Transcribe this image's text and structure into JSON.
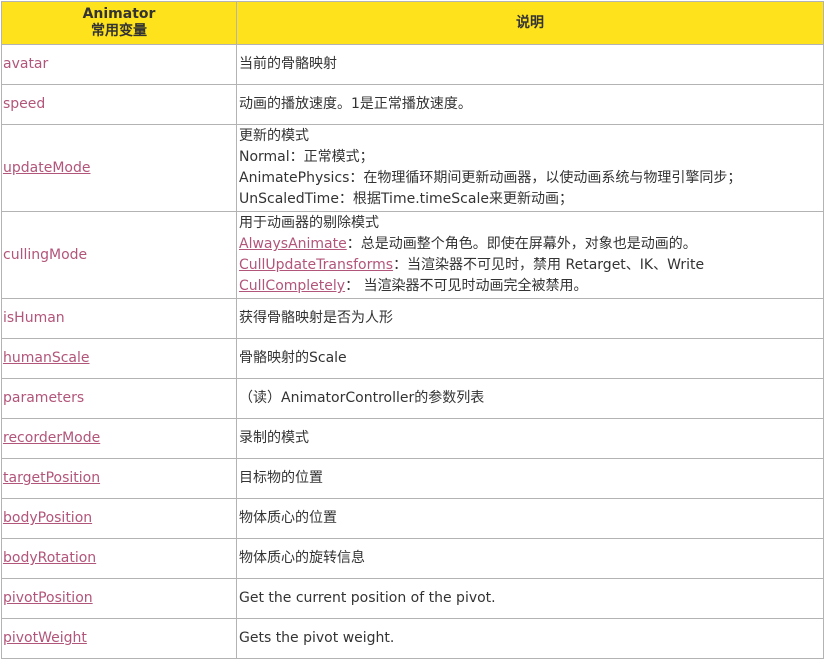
{
  "header": {
    "col1_line1": "Animator",
    "col1_line2": "常用变量",
    "col2": "说明"
  },
  "rows": [
    {
      "name": "avatar",
      "linked": false,
      "desc": "当前的骨骼映射"
    },
    {
      "name": "speed",
      "linked": false,
      "desc": "动画的播放速度。1是正常播放速度。"
    },
    {
      "name": "updateMode",
      "linked": true,
      "lines": [
        "更新的模式",
        "Normal：正常模式；",
        "AnimatePhysics：在物理循环期间更新动画器，以使动画系统与物理引擎同步；",
        "UnScaledTime：根据Time.timeScale来更新动画；"
      ]
    },
    {
      "name": "cullingMode",
      "linked": false,
      "intro": "用于动画器的剔除模式",
      "items": [
        {
          "link": "AlwaysAnimate",
          "text": "：总是动画整个角色。即使在屏幕外，对象也是动画的。"
        },
        {
          "link": "CullUpdateTransforms",
          "text": "：当渲染器不可见时，禁用 Retarget、IK、Write"
        },
        {
          "link": "CullCompletely",
          "text": "：  当渲染器不可见时动画完全被禁用。"
        }
      ]
    },
    {
      "name": "isHuman",
      "linked": false,
      "desc": "获得骨骼映射是否为人形"
    },
    {
      "name": "humanScale",
      "linked": true,
      "desc": "骨骼映射的Scale"
    },
    {
      "name": "parameters",
      "linked": false,
      "desc": "（读）AnimatorController的参数列表"
    },
    {
      "name": "recorderMode",
      "linked": true,
      "desc": "录制的模式"
    },
    {
      "name": "targetPosition",
      "linked": true,
      "desc": "目标物的位置"
    },
    {
      "name": "bodyPosition",
      "linked": true,
      "desc": "物体质心的位置"
    },
    {
      "name": "bodyRotation",
      "linked": true,
      "desc": "物体质心的旋转信息"
    },
    {
      "name": "pivotPosition",
      "linked": true,
      "desc": "Get the current position of the pivot."
    },
    {
      "name": "pivotWeight",
      "linked": true,
      "desc": "Gets the pivot weight."
    }
  ]
}
